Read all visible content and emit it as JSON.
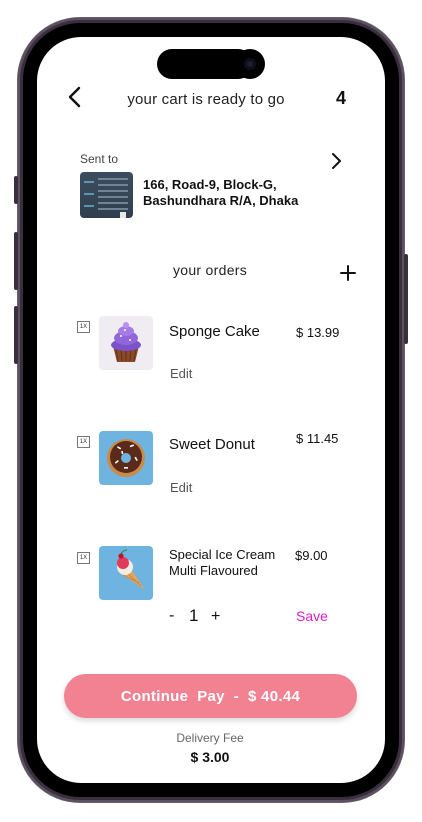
{
  "header": {
    "title": "your cart is ready to go",
    "cart_count": "4"
  },
  "address": {
    "sent_label": "Sent to",
    "line1": "166, Road-9, Block-G,",
    "line2": "Bashundhara R/A, Dhaka"
  },
  "orders": {
    "label": "your orders",
    "items": [
      {
        "qty_badge": "1X",
        "name": "Sponge Cake",
        "price": "$ 13.99",
        "edit": "Edit",
        "image_icon": "cupcake-icon"
      },
      {
        "qty_badge": "1X",
        "name": "Sweet Donut",
        "price": "$ 11.45",
        "edit": "Edit",
        "image_icon": "donut-icon"
      },
      {
        "qty_badge": "1X",
        "name_line1": "Special Ice Cream",
        "name_line2": "Multi Flavoured",
        "price": "$9.00",
        "stepper": {
          "minus": "-",
          "value": "1",
          "plus": "+"
        },
        "save": "Save",
        "image_icon": "ice-cream-icon"
      }
    ]
  },
  "checkout": {
    "pay_label": "Continue  Pay  -  $ 40.44",
    "delivery_label": "Delivery Fee",
    "delivery_fee": "$ 3.00"
  },
  "colors": {
    "pay_button": "#f28191",
    "save_link": "#d51ec8",
    "image_bg_blue": "#6fb3e0",
    "image_bg_gray": "#efedf1"
  }
}
